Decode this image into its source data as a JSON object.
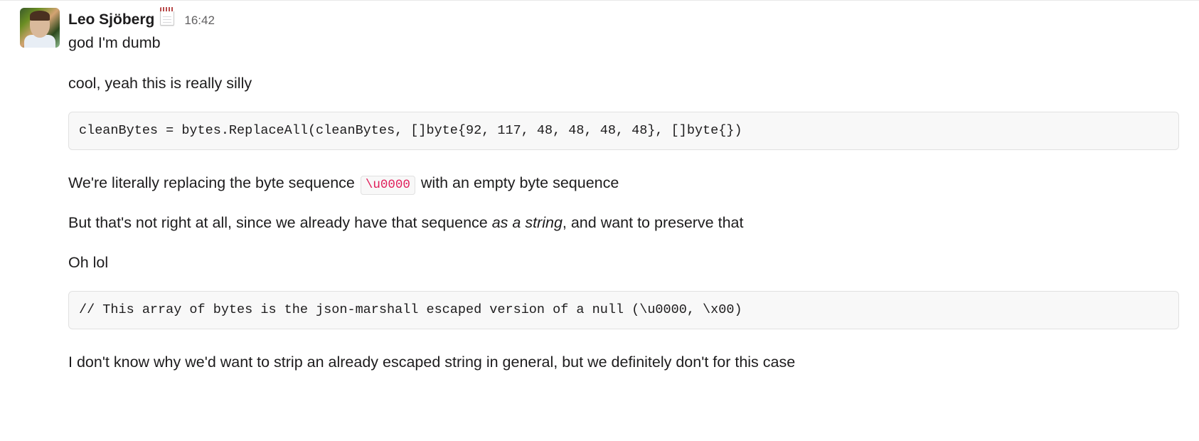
{
  "message": {
    "username": "Leo Sjöberg",
    "status_emoji": "spiral-notepad",
    "timestamp": "16:42",
    "lines": {
      "l1": "god I'm dumb",
      "l2": "cool, yeah this is really silly",
      "code1": "cleanBytes = bytes.ReplaceAll(cleanBytes, []byte{92, 117, 48, 48, 48, 48}, []byte{})",
      "l3_pre": "We're literally replacing the byte sequence ",
      "l3_code": "\\u0000",
      "l3_post": " with an empty byte sequence",
      "l4_pre": "But that's not right at all, since we already have that sequence ",
      "l4_em": "as a string",
      "l4_post": ", and want to preserve that",
      "l5": "Oh lol",
      "code2": "// This array of bytes is the json-marshall escaped version of a null (\\u0000, \\x00)",
      "l6": "I don't know why we'd want to strip an already escaped string in general, but we definitely don't for this case"
    }
  }
}
